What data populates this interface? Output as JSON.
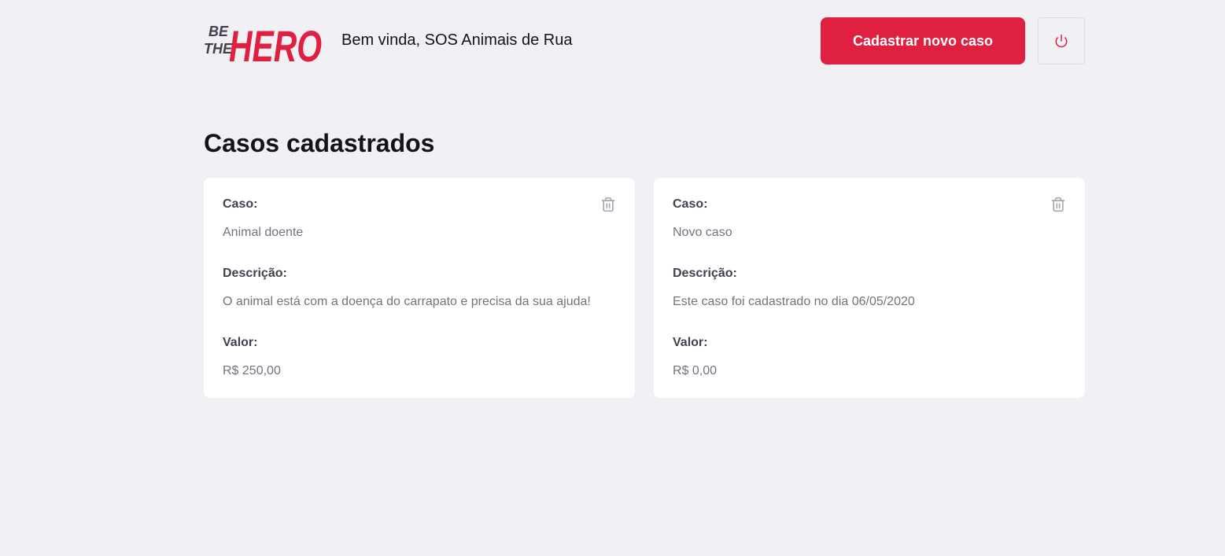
{
  "header": {
    "logo_line1": "BE",
    "logo_line2": "THE",
    "logo_main": "HERO",
    "welcome": "Bem vinda, SOS Animais de Rua",
    "new_case_label": "Cadastrar novo caso"
  },
  "main": {
    "title": "Casos cadastrados",
    "cases": [
      {
        "case_label": "Caso:",
        "case_value": "Animal doente",
        "description_label": "Descrição:",
        "description_value": "O animal está com a doença do carrapato e precisa da sua ajuda!",
        "value_label": "Valor:",
        "value_value": "R$ 250,00"
      },
      {
        "case_label": "Caso:",
        "case_value": "Novo caso",
        "description_label": "Descrição:",
        "description_value": "Este caso foi cadastrado no dia 06/05/2020",
        "value_label": "Valor:",
        "value_value": "R$ 0,00"
      }
    ]
  },
  "colors": {
    "background": "#f0f0f5",
    "accent": "#e02041",
    "logo_dark": "#41414d",
    "card": "#ffffff",
    "label": "#41414d",
    "muted": "#737380"
  },
  "icons": {
    "logout": "power-icon",
    "delete": "trash-icon"
  }
}
